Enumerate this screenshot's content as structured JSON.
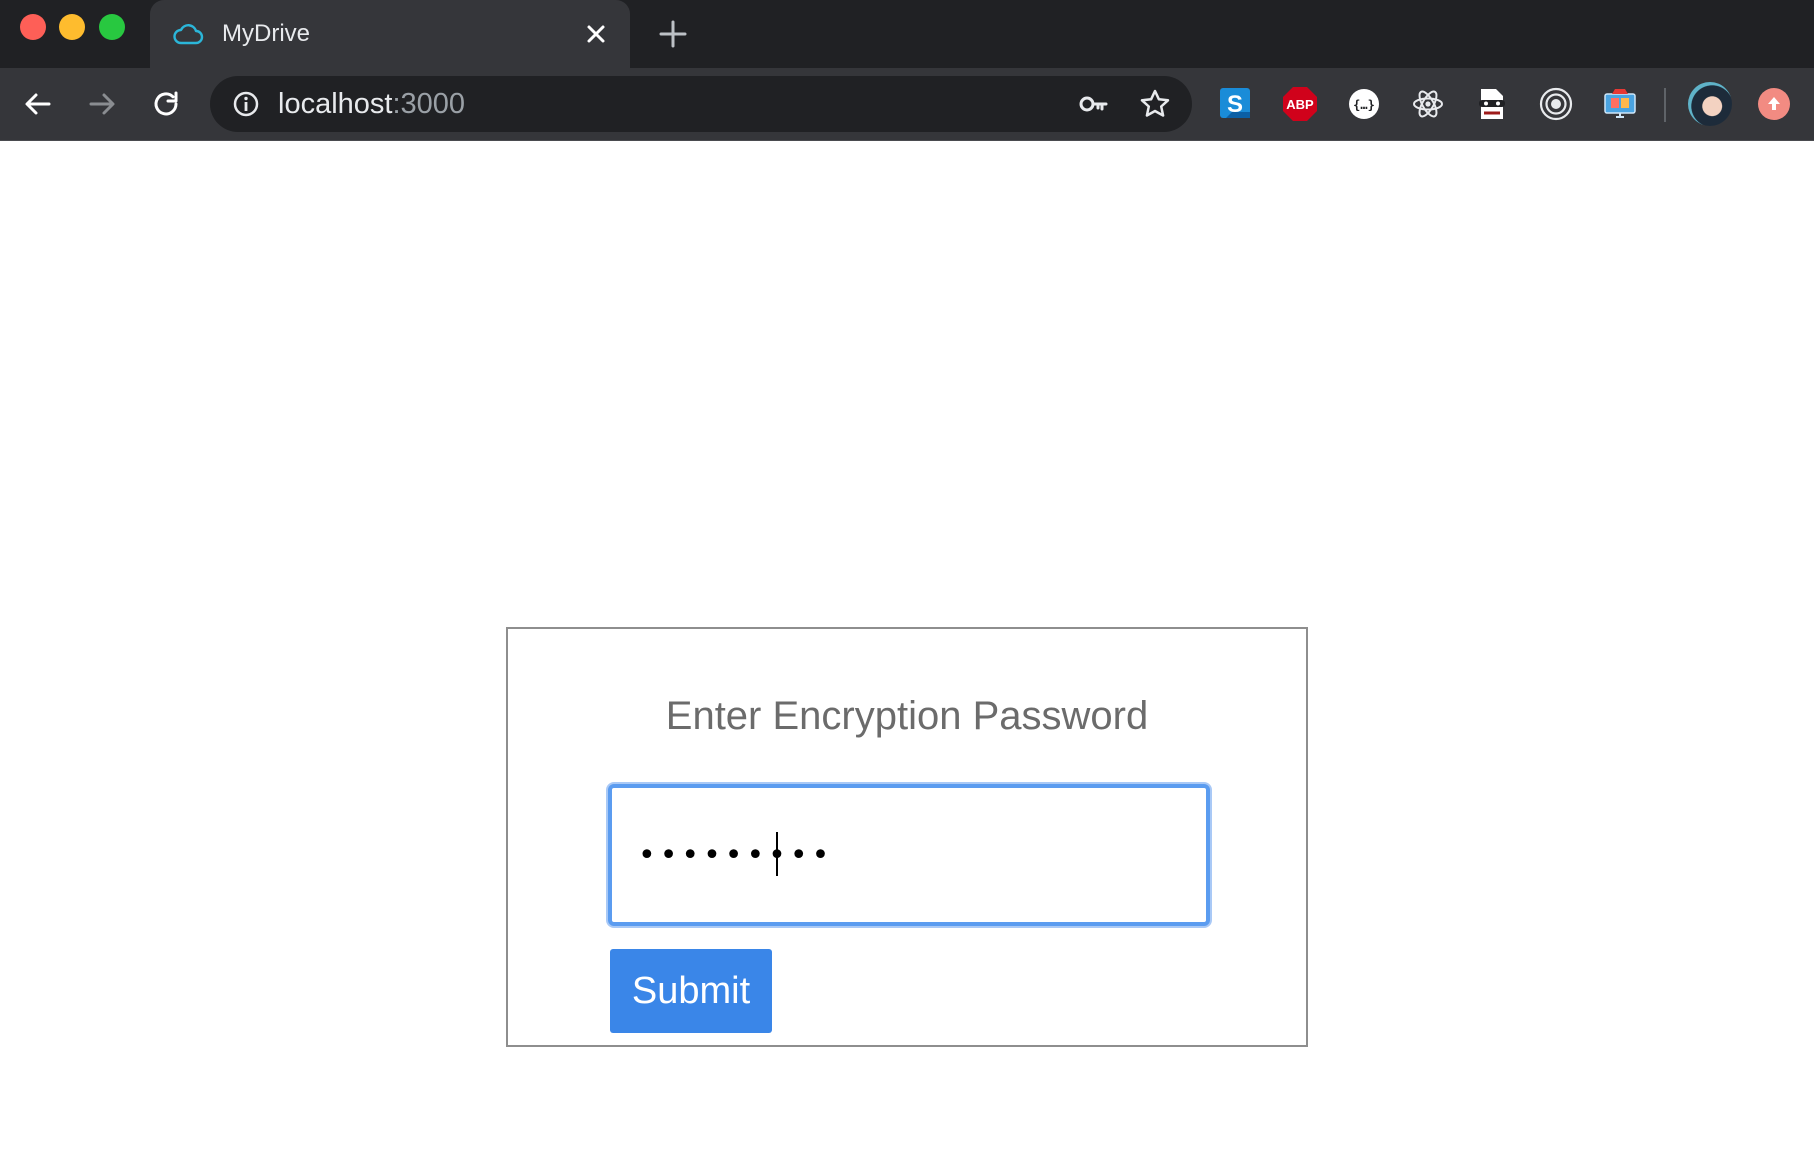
{
  "browser": {
    "tab": {
      "title": "MyDrive",
      "favicon": "cloud-icon"
    },
    "address": {
      "host": "localhost",
      "port": ":3000"
    },
    "extensions": [
      "skype-icon",
      "adblock-plus-icon",
      "json-formatter-icon",
      "react-devtools-icon",
      "incognito-mask-icon",
      "target-icon",
      "monitor-icon"
    ],
    "colors": {
      "chrome_dark": "#202124",
      "toolbar": "#35363a"
    }
  },
  "page": {
    "heading": "Enter Encryption Password",
    "password": {
      "masked_value": "•••••••••",
      "length": 9
    },
    "submit_label": "Submit",
    "colors": {
      "accent": "#3a86e8",
      "focus_ring": "#5b9cf0",
      "heading": "#6b6b6b"
    }
  }
}
